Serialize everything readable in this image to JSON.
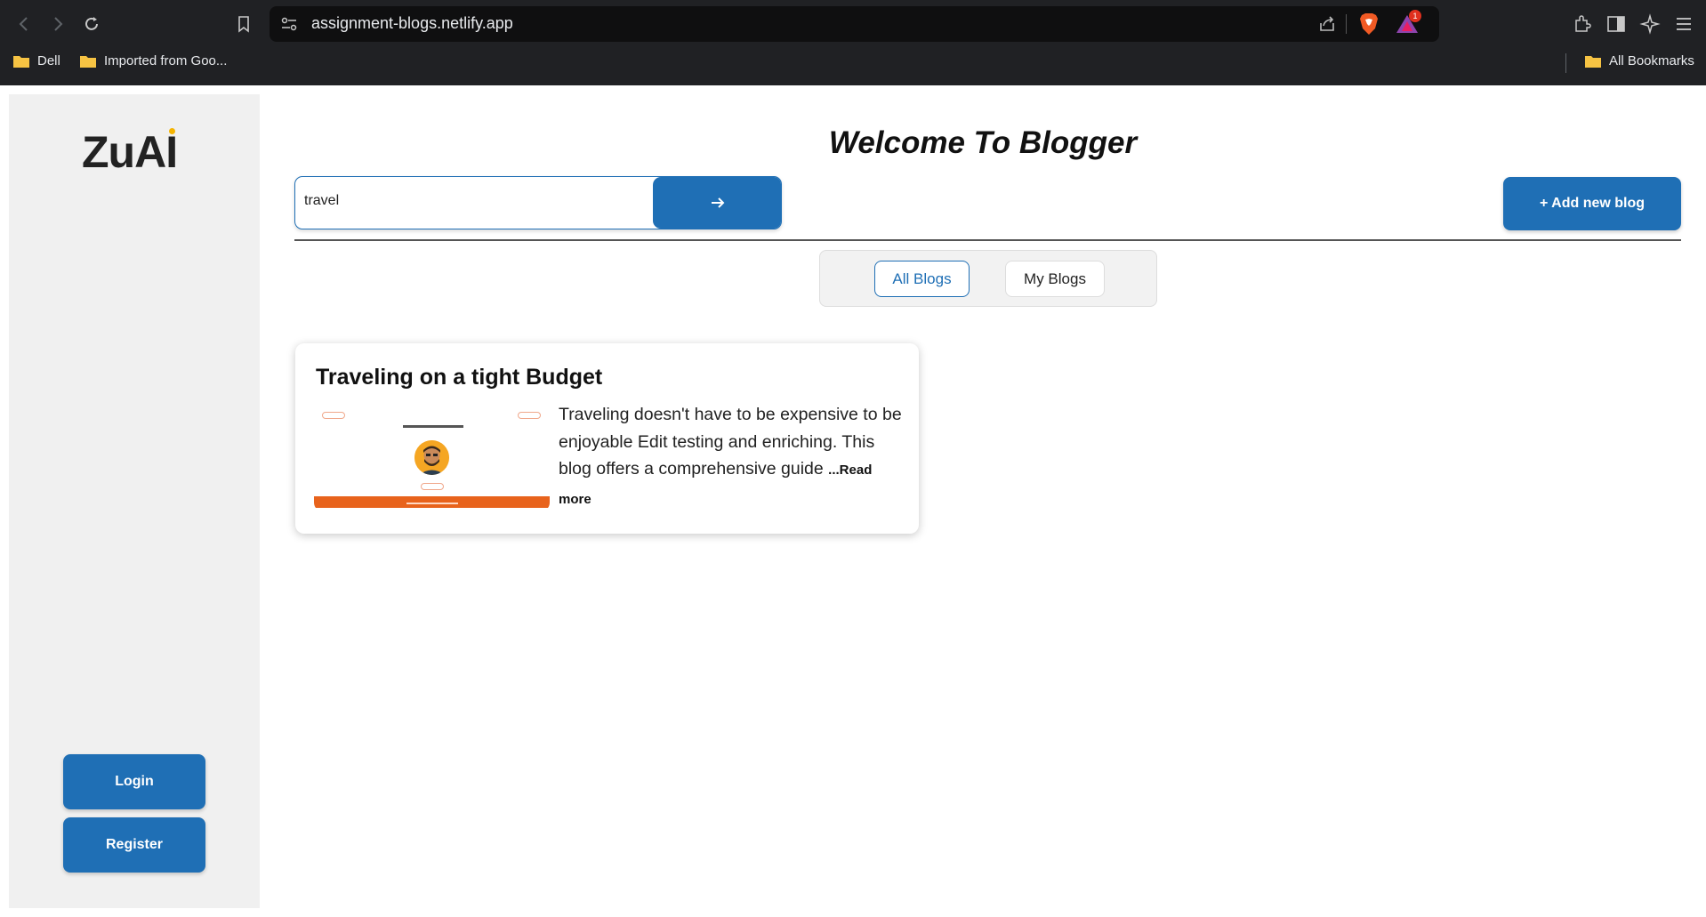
{
  "browser": {
    "url": "assignment-blogs.netlify.app",
    "rewards_badge": "1",
    "bookmarks": [
      "Dell",
      "Imported from Goo..."
    ],
    "all_bookmarks": "All Bookmarks"
  },
  "sidebar": {
    "logo": "ZuAI",
    "login_label": "Login",
    "register_label": "Register"
  },
  "header": {
    "title": "Welcome To Blogger"
  },
  "search": {
    "value": "travel"
  },
  "toolbar": {
    "add_label": "+ Add new blog"
  },
  "tabs": [
    {
      "label": "All Blogs",
      "active": true
    },
    {
      "label": "My Blogs",
      "active": false
    }
  ],
  "blogs": [
    {
      "title": "Traveling on a tight Budget",
      "excerpt": "Traveling doesn't have to be expensive to be enjoyable Edit testing and enriching. This blog offers a comprehensive guide",
      "read_more": "...Read more"
    }
  ],
  "colors": {
    "primary": "#1f6fb5",
    "chrome_bg": "#202124",
    "sidebar_bg": "#f0f0f0",
    "thumb_accent": "#e8631c"
  }
}
